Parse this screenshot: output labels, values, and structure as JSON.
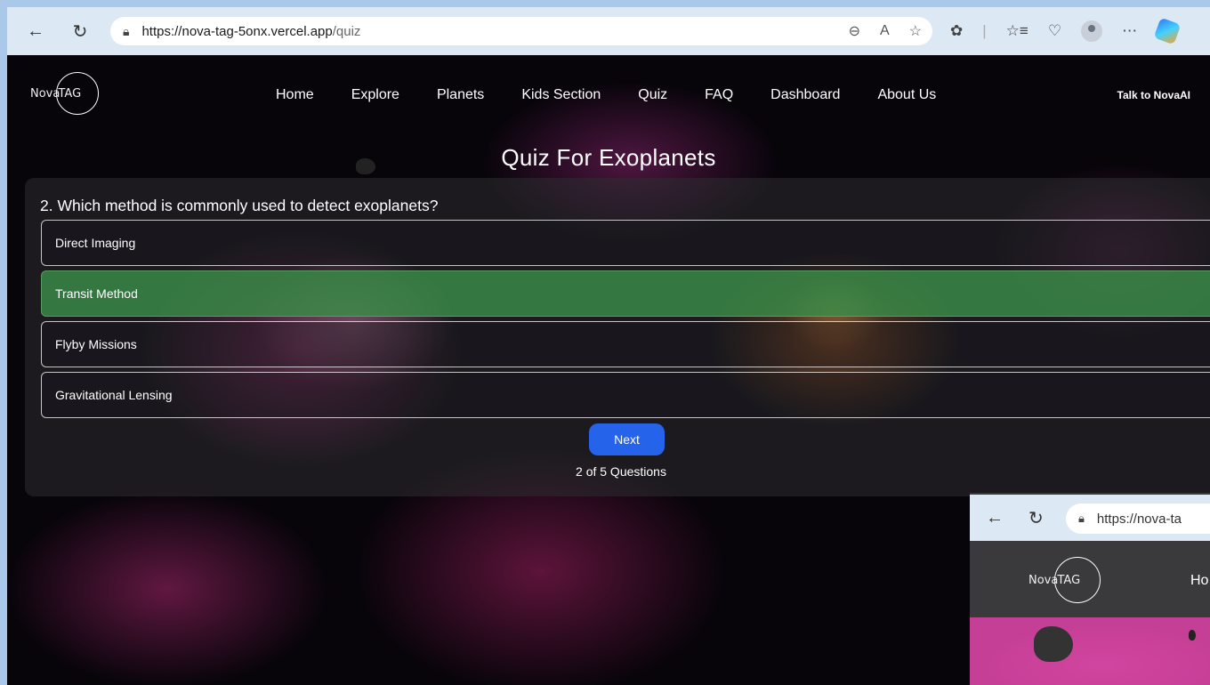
{
  "browser": {
    "url_host": "https://nova-tag-5onx.vercel.app",
    "url_path": "/quiz"
  },
  "site": {
    "logo_left": "Nova",
    "logo_right": "TAG",
    "nav": [
      "Home",
      "Explore",
      "Planets",
      "Kids Section",
      "Quiz",
      "FAQ",
      "Dashboard",
      "About Us"
    ],
    "talk_button": "Talk to NovaAI"
  },
  "quiz": {
    "title": "Quiz For Exoplanets",
    "question": "2. Which method is commonly used to detect exoplanets?",
    "options": [
      "Direct Imaging",
      "Transit Method",
      "Flyby Missions",
      "Gravitational Lensing"
    ],
    "selected_option": "Transit Method",
    "next_label": "Next",
    "progress_text": "2 of 5 Questions",
    "selected_color": "#3a8c48",
    "next_button_color": "#2563eb"
  },
  "nested_screenshot": {
    "url_fragment": "https://nova-ta",
    "logo_left": "Nova",
    "logo_right": "TAG",
    "nav_fragment": "Ho"
  },
  "icons": [
    "back-arrow-icon",
    "refresh-icon",
    "lock-icon",
    "zoom-out-icon",
    "read-aloud-icon",
    "favorite-star-icon",
    "extensions-icon",
    "favorites-icon",
    "browser-essentials-icon",
    "profile-icon",
    "more-icon",
    "copilot-icon"
  ]
}
